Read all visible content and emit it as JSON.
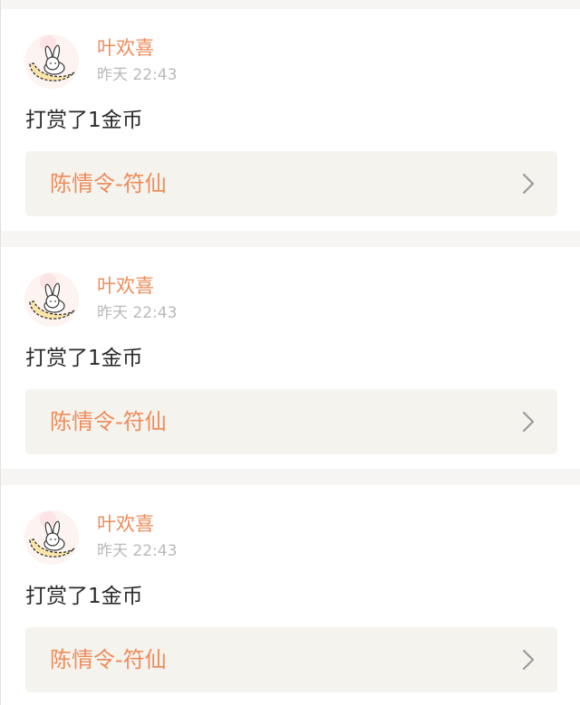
{
  "posts": [
    {
      "user_name": "叶欢喜",
      "time": "昨天 22:43",
      "text": "打赏了1金币",
      "link_title": "陈情令-符仙",
      "avatar_icon": "bunny-on-moon-icon",
      "chevron_icon": "chevron-right-icon"
    },
    {
      "user_name": "叶欢喜",
      "time": "昨天 22:43",
      "text": "打赏了1金币",
      "link_title": "陈情令-符仙",
      "avatar_icon": "bunny-on-moon-icon",
      "chevron_icon": "chevron-right-icon"
    },
    {
      "user_name": "叶欢喜",
      "time": "昨天 22:43",
      "text": "打赏了1金币",
      "link_title": "陈情令-符仙",
      "avatar_icon": "bunny-on-moon-icon",
      "chevron_icon": "chevron-right-icon"
    }
  ],
  "colors": {
    "accent": "#ee8c5a",
    "page_background": "#f7f5f3",
    "link_box_background": "#f4f3ee",
    "secondary_text": "#b9b9b9",
    "primary_text": "#2b2b2b"
  }
}
